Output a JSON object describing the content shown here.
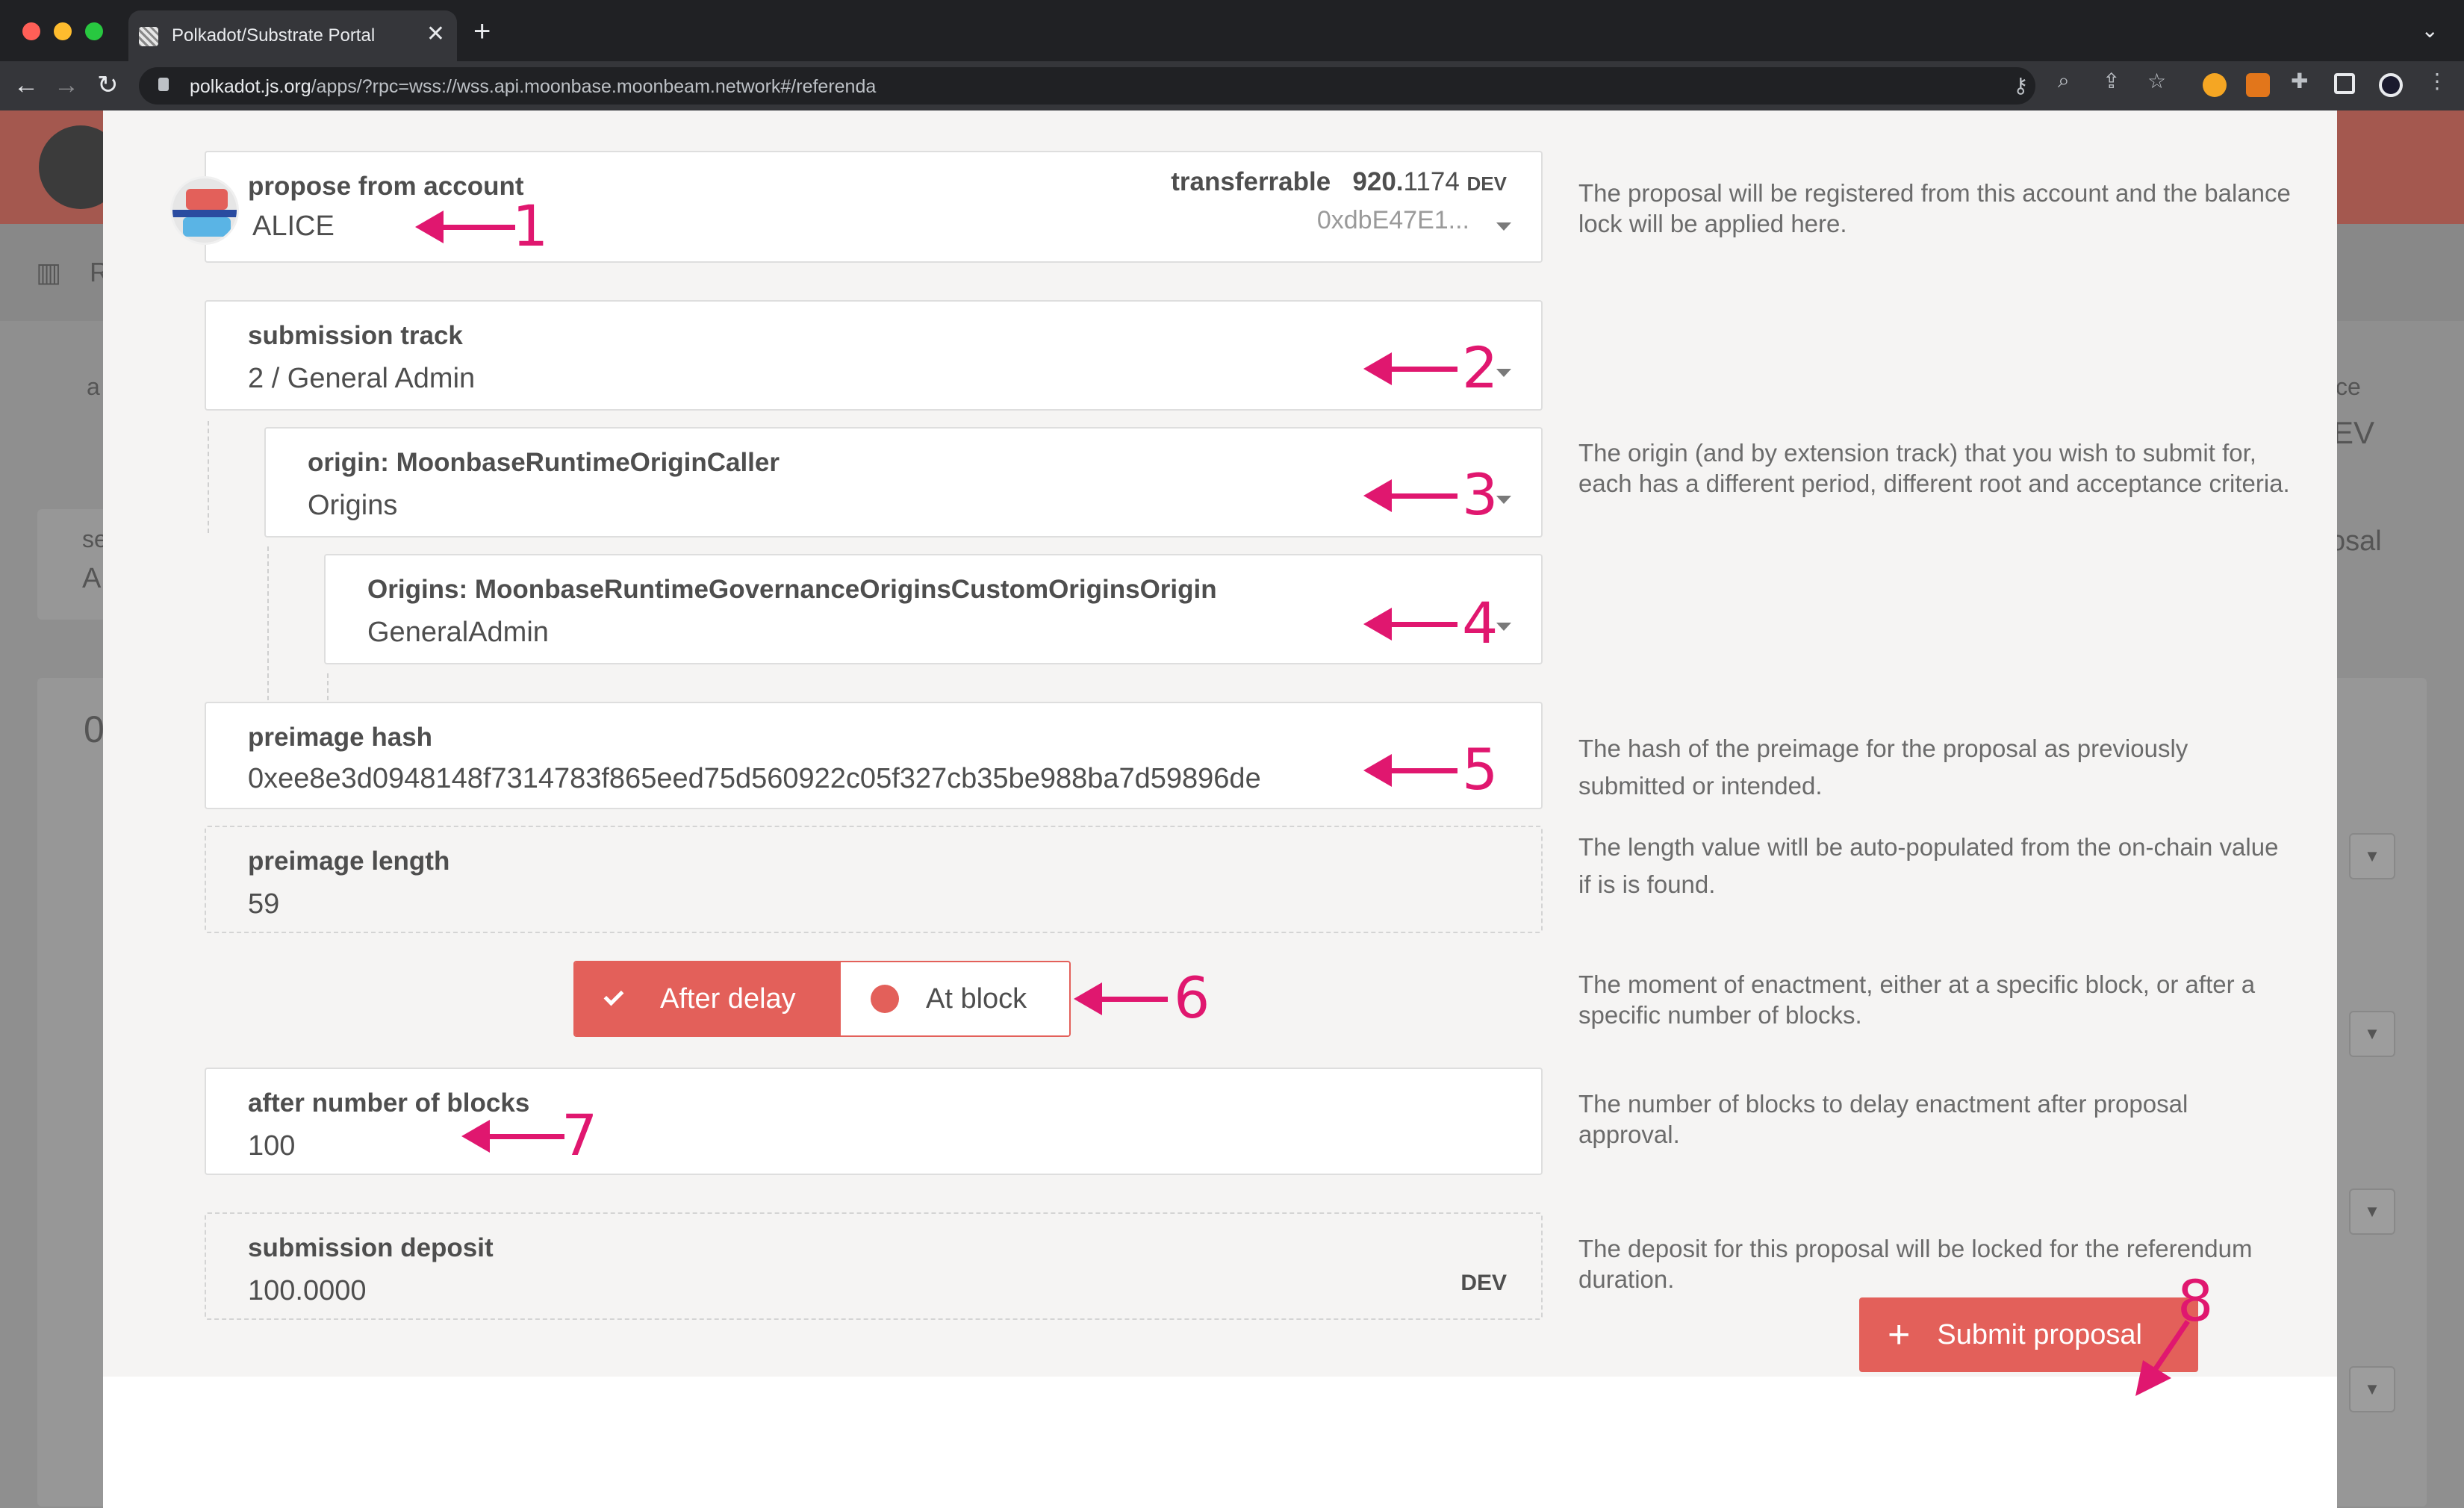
{
  "browser": {
    "tab_title": "Polkadot/Substrate Portal",
    "tab_close": "✕",
    "new_tab": "+",
    "url_host": "polkadot.js.org",
    "url_path": "/apps/?rpc=wss://wss.api.moonbase.moonbeam.network#/referenda"
  },
  "background": {
    "frag_a": "a",
    "frag_ce": "ce",
    "frag_ev": "EV",
    "frag_s": "se",
    "frag_a2": "A",
    "frag_osal": "osal",
    "frag_zero": "0",
    "frag_r": "R"
  },
  "form": {
    "account": {
      "label": "propose from account",
      "name": "ALICE",
      "transferrable_label": "transferrable",
      "transferrable_value_bold": "920.",
      "transferrable_value_rest": "1174",
      "transferrable_unit": "DEV",
      "address": "0xdbE47E1..."
    },
    "track": {
      "label": "submission track",
      "value": "2 / General Admin"
    },
    "origin": {
      "label": "origin: MoonbaseRuntimeOriginCaller",
      "value": "Origins"
    },
    "origins": {
      "label": "Origins: MoonbaseRuntimeGovernanceOriginsCustomOriginsOrigin",
      "value": "GeneralAdmin"
    },
    "preimage_hash": {
      "label": "preimage hash",
      "value": "0xee8e3d0948148f7314783f865eed75d560922c05f327cb35be988ba7d59896de"
    },
    "preimage_length": {
      "label": "preimage length",
      "value": "59"
    },
    "enactment": {
      "option_after_delay": "After delay",
      "option_at_block": "At block",
      "selected": "After delay"
    },
    "blocks": {
      "label": "after number of blocks",
      "value": "100"
    },
    "deposit": {
      "label": "submission deposit",
      "value": "100.0000",
      "unit": "DEV"
    },
    "submit_label": "Submit proposal"
  },
  "help": {
    "account": "The proposal will be registered from this account and the balance lock will be applied here.",
    "origin": "The origin (and by extension track) that you wish to submit for, each has a different period, different root and acceptance criteria.",
    "hash": "The hash of the preimage for the proposal as previously submitted or intended.",
    "length": "The length value witll be auto-populated from the on-chain value if is is found.",
    "enactment": "The moment of enactment, either at a specific block, or after a specific number of blocks.",
    "blocks": "The number of blocks to delay enactment after proposal approval.",
    "deposit": "The deposit for this proposal will be locked for the referendum duration."
  },
  "annotations": [
    "1",
    "2",
    "3",
    "4",
    "5",
    "6",
    "7",
    "8"
  ],
  "colors": {
    "accent": "#e3605a",
    "annotation": "#e0176f"
  }
}
